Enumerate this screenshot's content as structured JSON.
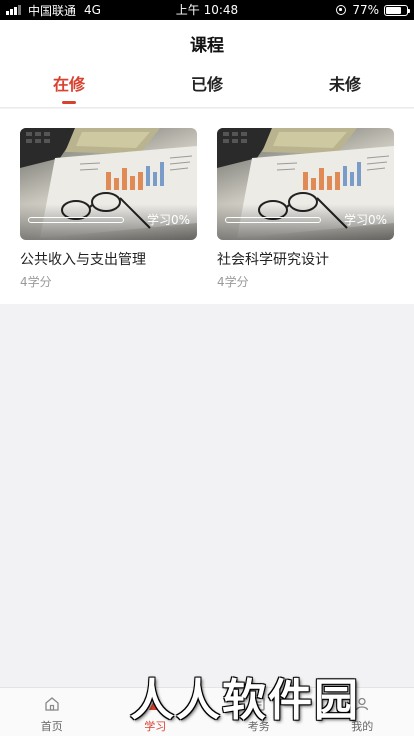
{
  "status_bar": {
    "carrier": "中国联通",
    "network": "4G",
    "time": "上午 10:48",
    "battery": "77%",
    "battery_level": 0.77
  },
  "header": {
    "title": "课程"
  },
  "tabs": [
    {
      "label": "在修",
      "active": true
    },
    {
      "label": "已修",
      "active": false
    },
    {
      "label": "未修",
      "active": false
    }
  ],
  "courses": [
    {
      "name": "公共收入与支出管理",
      "credit": "4学分",
      "progress_label": "学习0%",
      "progress": 0
    },
    {
      "name": "社会科学研究设计",
      "credit": "4学分",
      "progress_label": "学习0%",
      "progress": 0
    }
  ],
  "bottom_nav": [
    {
      "label": "首页",
      "icon": "home-icon",
      "active": false
    },
    {
      "label": "学习",
      "icon": "study-icon",
      "active": true
    },
    {
      "label": "考务",
      "icon": "exam-icon",
      "active": false
    },
    {
      "label": "我的",
      "icon": "profile-icon",
      "active": false
    }
  ],
  "watermark": "人人软件园",
  "colors": {
    "accent": "#d8412f",
    "background": "#f2f2f4"
  }
}
